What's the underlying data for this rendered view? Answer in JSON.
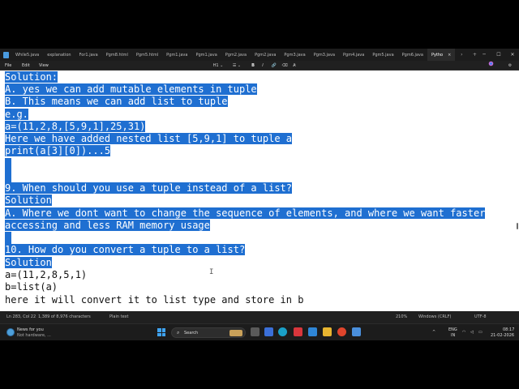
{
  "tabs": {
    "items": [
      "While5.java",
      "explanation",
      "For1.java",
      "Pgm8.html",
      "Pgm5.html",
      "Pgm1.java",
      "Pgm1.java",
      "Pgm2.java",
      "Pgm2.java",
      "Pgm3.java",
      "Pgm3.java",
      "Pgm4.java",
      "Pgm5.java",
      "Pgm6.java",
      "Pytho"
    ],
    "active_index": 14,
    "close_glyph": "×",
    "scroll_right_glyph": "›",
    "new_tab_glyph": "+",
    "minimize_glyph": "─",
    "maximize_glyph": "☐",
    "close_window_glyph": "✕"
  },
  "menu": {
    "file": "File",
    "edit": "Edit",
    "view": "View",
    "heading_tool": "H1 ⌄",
    "list_tool": "☰ ⌄",
    "bold": "B",
    "italic": "I",
    "link": "🔗",
    "strike": "⌫",
    "clear": "A̷",
    "settings_icon": "⚙"
  },
  "document": {
    "lines": [
      {
        "text": "Solution:",
        "selected": true
      },
      {
        "text": "A. yes we can add mutable elements in tuple",
        "selected": true
      },
      {
        "text": "B. This means we can add list to tuple",
        "selected": true
      },
      {
        "text": "e.g.",
        "selected": true
      },
      {
        "text": "a=(11,2,8,[5,9,1],25,31)",
        "selected": true
      },
      {
        "text": "Here we have added nested list [5,9,1] to tuple a",
        "selected": true
      },
      {
        "text": "print(a[3][0])...5",
        "selected": true
      },
      {
        "text": "",
        "selected": true
      },
      {
        "text": "",
        "selected": true
      },
      {
        "text": "9. When should you use a tuple instead of a list?",
        "selected": true
      },
      {
        "text": "Solution",
        "selected": true
      },
      {
        "text": "A. Where we dont want to change the sequence of elements, and where we want faster",
        "selected": true
      },
      {
        "text": "accessing and less RAM memory usage",
        "selected": true
      },
      {
        "text": "",
        "selected": true
      },
      {
        "text": "10. How do you convert a tuple to a list?",
        "selected": true
      },
      {
        "text": "Solution",
        "selected": true
      },
      {
        "text": "a=(11,2,8,5,1)",
        "selected": false
      },
      {
        "text": "b=list(a)",
        "selected": false
      },
      {
        "text": "here it will convert it to list type and store in b",
        "selected": false
      }
    ],
    "selection_color": "#1f6fd1"
  },
  "status": {
    "position": "Ln 283, Col 22",
    "chars": "1,389 of 8,976 characters",
    "format": "Plain text",
    "zoom": "210%",
    "line_ending": "Windows (CRLF)",
    "encoding": "UTF-8"
  },
  "taskbar": {
    "weather_title": "News for you",
    "weather_sub": "Not hardware, ...",
    "search_label": "Search",
    "lang_top": "ENG",
    "lang_bottom": "IN",
    "time": "08:17",
    "date": "21-02-2026",
    "tray_arrow": "^"
  }
}
